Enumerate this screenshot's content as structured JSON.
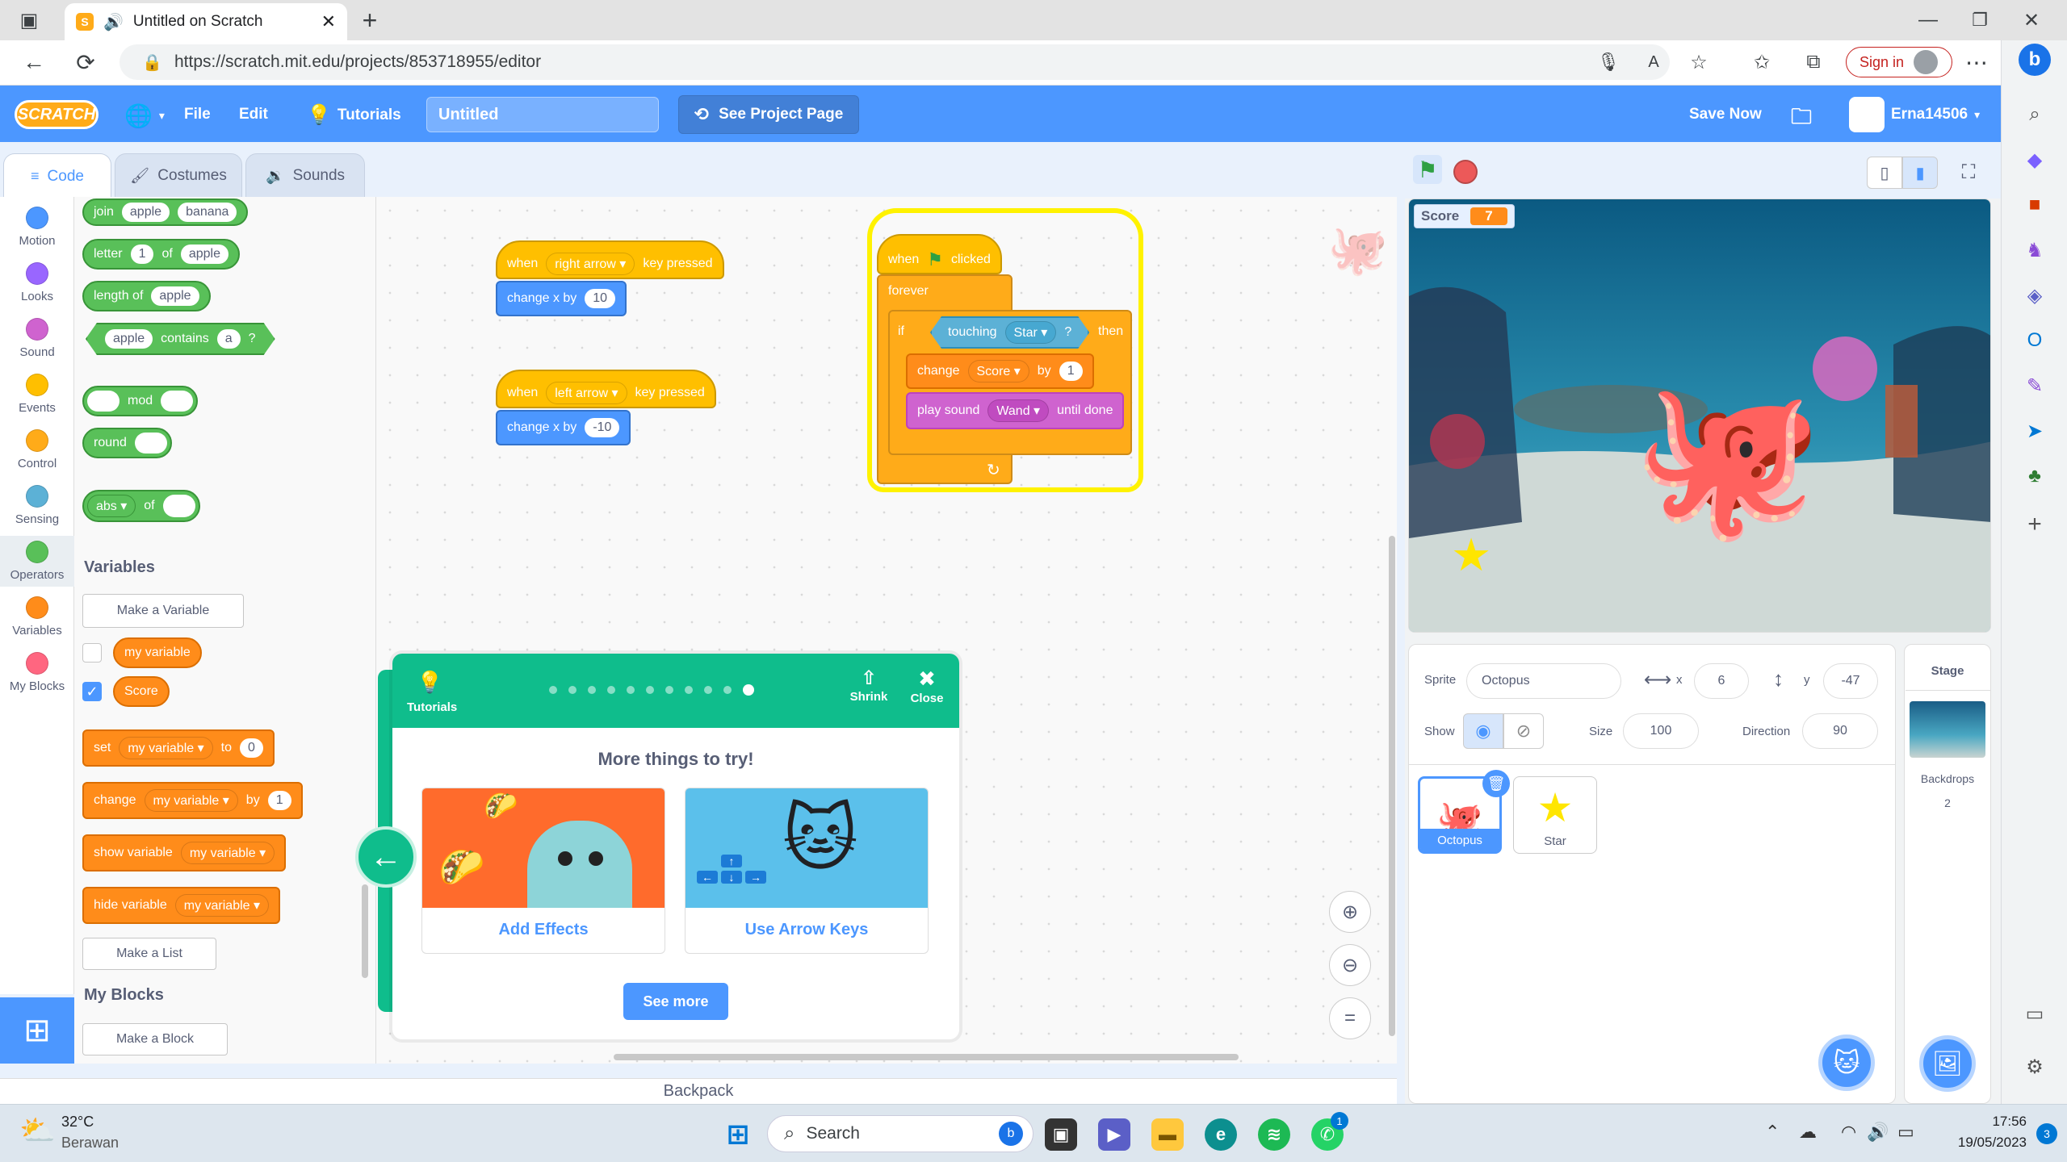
{
  "browser": {
    "tab_title": "Untitled on Scratch",
    "url": "https://scratch.mit.edu/projects/853718955/editor",
    "sign_in": "Sign in"
  },
  "menubar": {
    "logo": "SCRATCH",
    "file": "File",
    "edit": "Edit",
    "tutorials": "Tutorials",
    "project_title": "Untitled",
    "see_project_page": "See Project Page",
    "save_now": "Save Now",
    "username": "Erna14506"
  },
  "editor_tabs": {
    "code": "Code",
    "costumes": "Costumes",
    "sounds": "Sounds"
  },
  "categories": [
    {
      "label": "Motion",
      "color": "#4c97ff"
    },
    {
      "label": "Looks",
      "color": "#9966ff"
    },
    {
      "label": "Sound",
      "color": "#cf63cf"
    },
    {
      "label": "Events",
      "color": "#ffbf00"
    },
    {
      "label": "Control",
      "color": "#ffab19"
    },
    {
      "label": "Sensing",
      "color": "#5cb1d6"
    },
    {
      "label": "Operators",
      "color": "#59c059"
    },
    {
      "label": "Variables",
      "color": "#ff8c1a"
    },
    {
      "label": "My Blocks",
      "color": "#ff6680"
    }
  ],
  "palette": {
    "join": {
      "op": "join",
      "a": "apple",
      "b": "banana"
    },
    "letter": {
      "op": "letter",
      "n": "1",
      "of": "of",
      "s": "apple"
    },
    "length": {
      "op": "length of",
      "s": "apple"
    },
    "contains": {
      "a": "apple",
      "op": "contains",
      "b": "a",
      "q": "?"
    },
    "mod": "mod",
    "round": "round",
    "abs": {
      "fn": "abs",
      "of": "of"
    },
    "variables_header": "Variables",
    "make_variable": "Make a Variable",
    "var1": "my variable",
    "var2": "Score",
    "set": {
      "op": "set",
      "var": "my variable",
      "to": "to",
      "val": "0"
    },
    "change": {
      "op": "change",
      "var": "my variable",
      "by": "by",
      "val": "1"
    },
    "show_variable": {
      "op": "show variable",
      "var": "my variable"
    },
    "hide_variable": {
      "op": "hide variable",
      "var": "my variable"
    },
    "make_list": "Make a List",
    "myblocks_header": "My Blocks",
    "make_block": "Make a Block"
  },
  "scripts": {
    "right": {
      "when": "when",
      "key": "right arrow",
      "pressed": "key pressed",
      "change": "change x by",
      "val": "10"
    },
    "left": {
      "when": "when",
      "key": "left arrow",
      "pressed": "key pressed",
      "change": "change x by",
      "val": "-10"
    },
    "main": {
      "when": "when",
      "clicked": "clicked",
      "forever": "forever",
      "if": "if",
      "touching": "touching",
      "target": "Star",
      "q": "?",
      "then": "then",
      "change": "change",
      "var": "Score",
      "by": "by",
      "val": "1",
      "play": "play sound",
      "sound": "Wand",
      "until": "until done"
    }
  },
  "modal": {
    "tutorials": "Tutorials",
    "shrink": "Shrink",
    "close": "Close",
    "heading": "More things to try!",
    "card1": "Add Effects",
    "card2": "Use Arrow Keys",
    "see_more": "See more"
  },
  "stage": {
    "monitor_label": "Score",
    "monitor_value": "7"
  },
  "sprite_info": {
    "sprite_label": "Sprite",
    "sprite_name": "Octopus",
    "x_label": "x",
    "x": "6",
    "y_label": "y",
    "y": "-47",
    "show_label": "Show",
    "size_label": "Size",
    "size": "100",
    "direction_label": "Direction",
    "direction": "90"
  },
  "sprites": [
    {
      "name": "Octopus"
    },
    {
      "name": "Star"
    }
  ],
  "stage_panel": {
    "title": "Stage",
    "backdrops_label": "Backdrops",
    "backdrops_count": "2"
  },
  "backpack": "Backpack",
  "taskbar": {
    "temp": "32°C",
    "weather": "Berawan",
    "search": "Search",
    "time": "17:56",
    "date": "19/05/2023",
    "notif": "3",
    "whatsapp_badge": "1"
  }
}
